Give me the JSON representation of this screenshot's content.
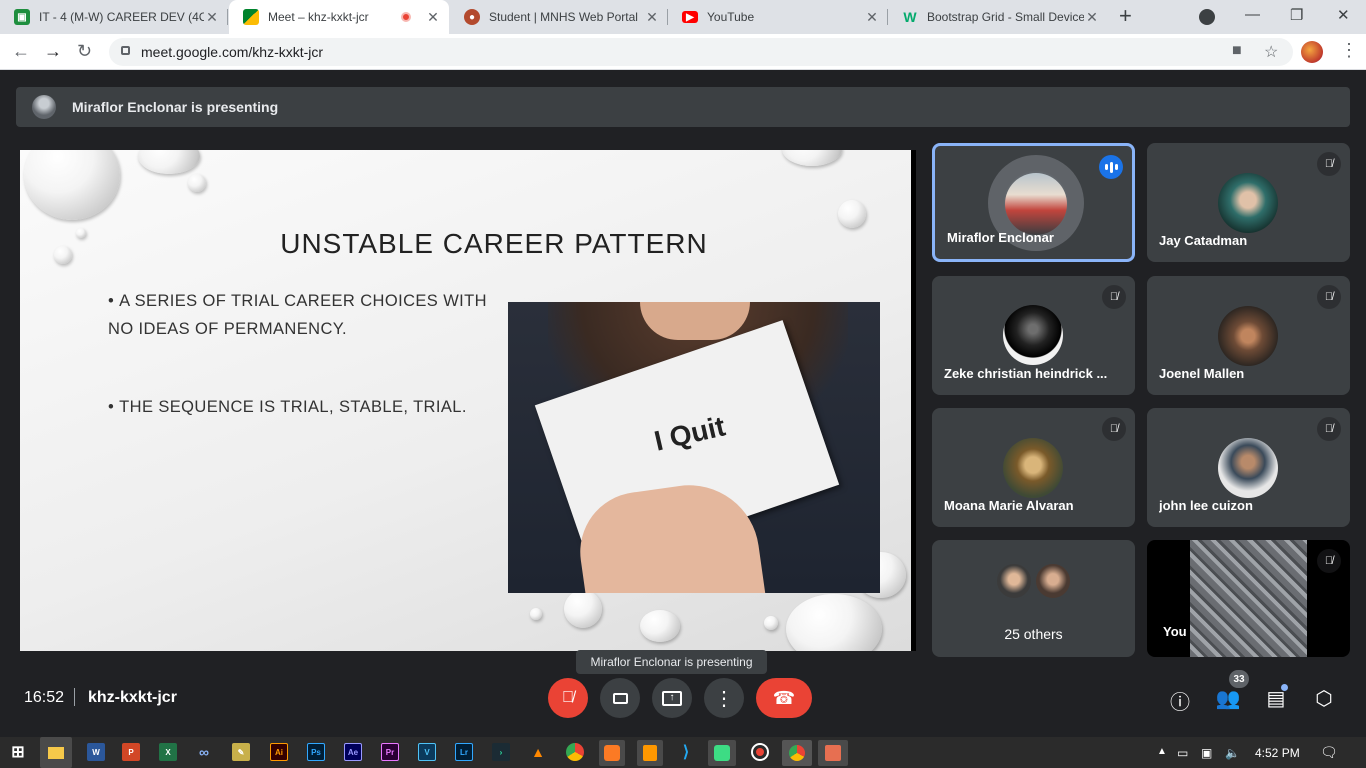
{
  "tabs": [
    {
      "title": "IT - 4 (M-W) CAREER DEV (4C",
      "icon": "classroom-icon",
      "color": "#1e8e3e",
      "active": false
    },
    {
      "title": "Meet – khz-kxkt-jcr",
      "icon": "meet-icon",
      "color": "#00832d",
      "active": true
    },
    {
      "title": "Student | MNHS Web Portal",
      "icon": "school-icon",
      "color": "#b34a2e",
      "active": false
    },
    {
      "title": "YouTube",
      "icon": "youtube-icon",
      "color": "#ff0000",
      "active": false
    },
    {
      "title": "Bootstrap Grid - Small Device",
      "icon": "w3schools-icon",
      "color": "#04aa6d",
      "active": false
    }
  ],
  "address": {
    "url": "meet.google.com/khz-kxkt-jcr"
  },
  "presentation_banner": {
    "text": "Miraflor Enclonar is presenting"
  },
  "slide": {
    "title": "UNSTABLE CAREER PATTERN",
    "bullets": [
      "A SERIES OF TRIAL CAREER CHOICES WITH NO IDEAS OF PERMANENCY.",
      "THE SEQUENCE IS TRIAL, STABLE, TRIAL."
    ],
    "image_text": "I Quit"
  },
  "participants": [
    {
      "name": "Miraflor Enclonar",
      "state": "speaking"
    },
    {
      "name": "Jay Catadman",
      "state": "muted"
    },
    {
      "name": "Zeke christian heindrick ...",
      "state": "muted"
    },
    {
      "name": "Joenel Mallen",
      "state": "muted"
    },
    {
      "name": "Moana Marie Alvaran",
      "state": "muted"
    },
    {
      "name": "john lee cuizon",
      "state": "muted"
    }
  ],
  "others": {
    "label": "25 others"
  },
  "self": {
    "label": "You"
  },
  "tooltip": {
    "text": "Miraflor Enclonar is presenting"
  },
  "meeting": {
    "time": "16:52",
    "code": "khz-kxkt-jcr",
    "participant_count": "33"
  },
  "controls": [
    "mic-muted",
    "camera",
    "present-screen",
    "more-options",
    "leave-call"
  ],
  "right_controls": [
    "meeting-details",
    "people",
    "chat",
    "activities"
  ],
  "taskbar": {
    "time": "4:52 PM"
  },
  "colors": {
    "accent_blue": "#8ab4f8",
    "end_red": "#ea4335",
    "surface": "#3c4043",
    "background": "#202124"
  }
}
